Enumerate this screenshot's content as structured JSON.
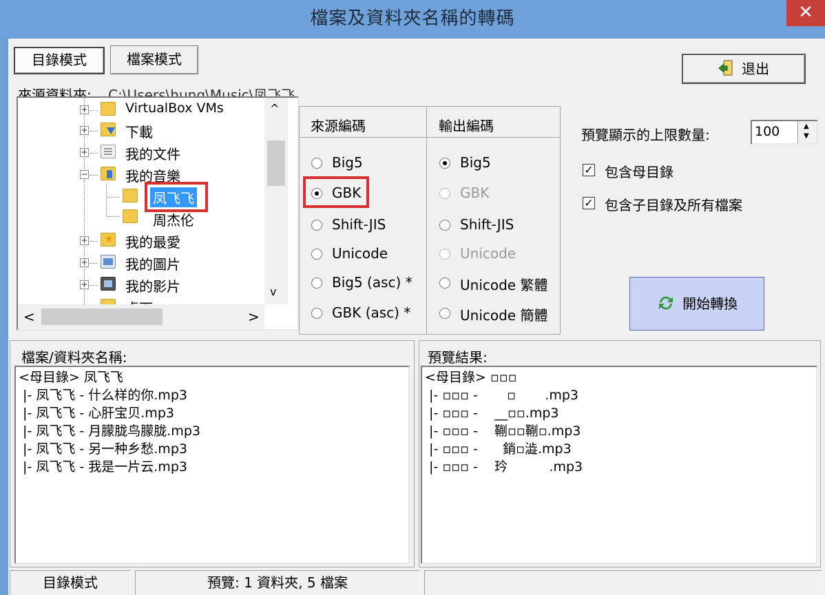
{
  "window": {
    "title": "檔案及資料夾名稱的轉碼",
    "close_glyph": "✕"
  },
  "tabs": [
    {
      "label": "目錄模式",
      "active": true
    },
    {
      "label": "檔案模式",
      "active": false
    }
  ],
  "exit_button": {
    "label": "退出",
    "icon": "exit-door-icon"
  },
  "source_folder": {
    "label": "來源資料夾:",
    "path": "C:\\Users\\hung\\Music\\凤飞飞"
  },
  "tree": {
    "items": [
      {
        "label": "VirtualBox VMs",
        "expander": "+",
        "icon": "folder-icon"
      },
      {
        "label": "下載",
        "expander": "+",
        "icon": "download-folder-icon"
      },
      {
        "label": "我的文件",
        "expander": "+",
        "icon": "documents-folder-icon"
      },
      {
        "label": "我的音樂",
        "expander": "−",
        "icon": "music-folder-icon"
      },
      {
        "label": "凤飞飞",
        "expander": "",
        "icon": "folder-icon",
        "selected": true
      },
      {
        "label": "周杰伦",
        "expander": "",
        "icon": "folder-icon"
      },
      {
        "label": "我的最愛",
        "expander": "+",
        "icon": "favorites-folder-icon"
      },
      {
        "label": "我的圖片",
        "expander": "+",
        "icon": "pictures-folder-icon"
      },
      {
        "label": "我的影片",
        "expander": "+",
        "icon": "videos-folder-icon"
      },
      {
        "label": "桌面",
        "expander": "",
        "icon": "folder-icon"
      }
    ]
  },
  "encoding": {
    "source_header": "來源編碼",
    "output_header": "輸出編碼",
    "source_options": [
      {
        "label": "Big5",
        "checked": false,
        "disabled": false
      },
      {
        "label": "GBK",
        "checked": true,
        "disabled": false
      },
      {
        "label": "Shift-JIS",
        "checked": false,
        "disabled": false
      },
      {
        "label": "Unicode",
        "checked": false,
        "disabled": false
      },
      {
        "label": "Big5 (asc) *",
        "checked": false,
        "disabled": false
      },
      {
        "label": "GBK (asc) *",
        "checked": false,
        "disabled": false
      }
    ],
    "output_options": [
      {
        "label": "Big5",
        "checked": true,
        "disabled": false
      },
      {
        "label": "GBK",
        "checked": false,
        "disabled": true
      },
      {
        "label": "Shift-JIS",
        "checked": false,
        "disabled": false
      },
      {
        "label": "Unicode",
        "checked": false,
        "disabled": true
      },
      {
        "label": "Unicode 繁體",
        "checked": false,
        "disabled": false
      },
      {
        "label": "Unicode 簡體",
        "checked": false,
        "disabled": false
      }
    ]
  },
  "options": {
    "preview_limit_label": "預覽顯示的上限數量:",
    "preview_limit_value": "100",
    "include_parent_label": "包含母目錄",
    "include_parent_checked": true,
    "include_sub_label": "包含子目錄及所有檔案",
    "include_sub_checked": true
  },
  "start_button": {
    "label": "開始轉換",
    "icon": "refresh-icon"
  },
  "file_list": {
    "header": "檔案/資料夾名稱:",
    "lines": [
      "<母目錄> 凤飞飞",
      " |- 凤飞飞 - 什么样的你.mp3",
      " |- 凤飞飞 - 心肝宝贝.mp3",
      " |- 凤飞飞 - 月朦胧鸟朦胧.mp3",
      " |- 凤飞飞 - 另一种乡愁.mp3",
      " |- 凤飞飞 - 我是一片云.mp3"
    ]
  },
  "preview": {
    "header": "預覽結果:",
    "lines": [
      "<母目錄> ▫▫▫",
      " |- ▫▫▫ -       ▫       .mp3",
      " |- ▫▫▫ -    __▫▫.mp3",
      " |- ▫▫▫ -    鞩▫▫鞩▫.mp3",
      " |- ▫▫▫ -      銷▫澁.mp3",
      " |- ▫▫▫ -    玪          .mp3"
    ]
  },
  "status": {
    "mode": "目錄模式",
    "summary": "預覽: 1 資料夾, 5 檔案",
    "extra": ""
  },
  "colors": {
    "titlebar": "#6fa2db",
    "selection_highlight": "#3399ff",
    "annotation_red": "#d63030",
    "start_button_bg": "#c9d3f5"
  }
}
